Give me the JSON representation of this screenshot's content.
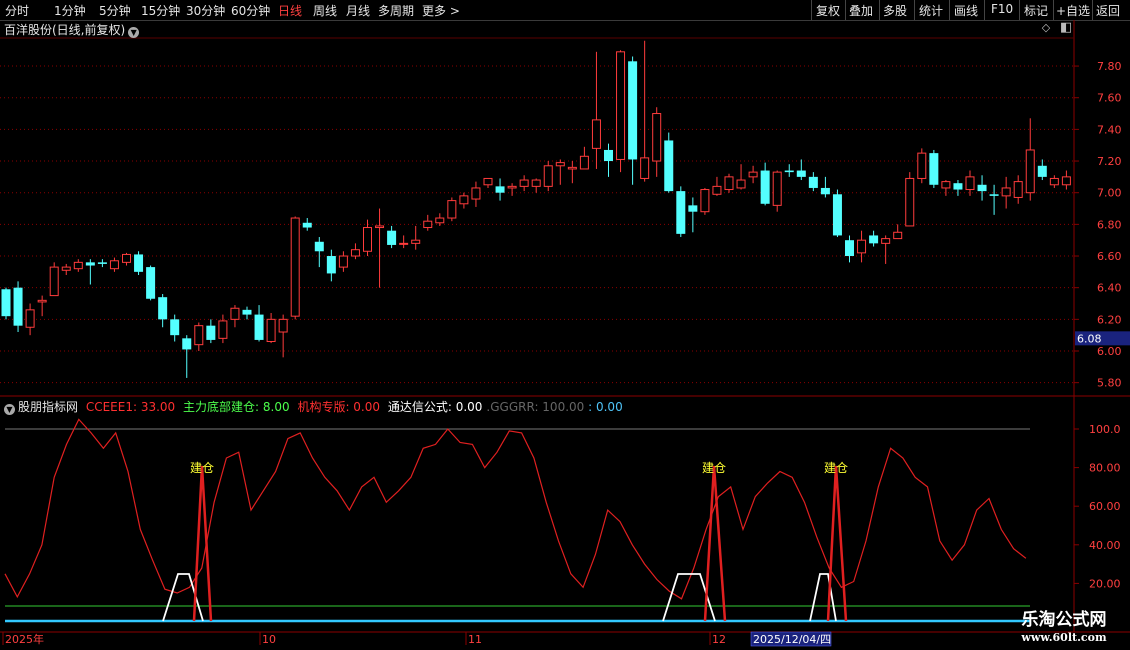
{
  "toolbar": {
    "periods": [
      "分时",
      "1分钟",
      "5分钟",
      "15分钟",
      "30分钟",
      "60分钟",
      "日线",
      "周线",
      "月线",
      "多周期",
      "更多 >"
    ],
    "active_period": "日线",
    "right_buttons": [
      "复权",
      "叠加",
      "多股",
      "统计",
      "画线",
      "F10",
      "标记",
      "+自选",
      "返回"
    ]
  },
  "main_chart": {
    "title": "百洋股份(日线,前复权)",
    "price_axis": [
      "7.80",
      "7.60",
      "7.40",
      "7.20",
      "7.00",
      "6.80",
      "6.60",
      "6.40",
      "6.20",
      "6.00",
      "5.80"
    ],
    "current_price_tag": "6.08",
    "colors": {
      "up": "#ff3c3c",
      "down": "#54ffff",
      "grid": "#8b0000",
      "tag_bg": "#1a237e"
    }
  },
  "indicator": {
    "name": "股朋指标网",
    "values": [
      {
        "label": "CCEEE1: 33.00",
        "color": "#ff3030"
      },
      {
        "label": "主力底部建仓: 8.00",
        "color": "#4cff4c"
      },
      {
        "label": "机构专版: 0.00",
        "color": "#ff3030"
      },
      {
        "label": "通达信公式: 0.00",
        "color": "#ffffff"
      },
      {
        "label": ".GGGRR: 100.00",
        "color": "#666666"
      },
      {
        "label": ": 0.00",
        "color": "#4fc3f7"
      }
    ],
    "axis": [
      "100.0",
      "80.00",
      "60.00",
      "40.00",
      "20.00"
    ],
    "signal_label": "建仓",
    "signal_color": "#ffff33"
  },
  "date_axis": {
    "labels": [
      "2025年",
      "10",
      "11",
      "12"
    ],
    "cursor_date": "2025/12/04/四"
  },
  "watermark": {
    "line1": "乐淘公式网",
    "line2": "www.60lt.com"
  },
  "chart_data": [
    {
      "type": "candlestick",
      "title": "百洋股份(日线,前复权)",
      "ylim": [
        5.75,
        7.95
      ],
      "candles": [
        [
          6.39,
          6.22,
          6.4,
          6.2
        ],
        [
          6.4,
          6.16,
          6.44,
          6.12
        ],
        [
          6.15,
          6.26,
          6.3,
          6.1
        ],
        [
          6.31,
          6.32,
          6.35,
          6.22
        ],
        [
          6.35,
          6.53,
          6.56,
          6.35
        ],
        [
          6.51,
          6.53,
          6.55,
          6.48
        ],
        [
          6.52,
          6.56,
          6.58,
          6.5
        ],
        [
          6.56,
          6.54,
          6.58,
          6.42
        ],
        [
          6.56,
          6.55,
          6.58,
          6.53
        ],
        [
          6.52,
          6.57,
          6.59,
          6.5
        ],
        [
          6.56,
          6.61,
          6.62,
          6.54
        ],
        [
          6.61,
          6.5,
          6.63,
          6.48
        ],
        [
          6.53,
          6.33,
          6.54,
          6.32
        ],
        [
          6.34,
          6.2,
          6.36,
          6.15
        ],
        [
          6.2,
          6.1,
          6.23,
          6.06
        ],
        [
          6.08,
          6.01,
          6.1,
          5.83
        ],
        [
          6.04,
          6.16,
          6.18,
          6.0
        ],
        [
          6.16,
          6.07,
          6.2,
          6.05
        ],
        [
          6.08,
          6.19,
          6.23,
          6.05
        ],
        [
          6.2,
          6.27,
          6.29,
          6.15
        ],
        [
          6.26,
          6.23,
          6.28,
          6.2
        ],
        [
          6.23,
          6.07,
          6.29,
          6.06
        ],
        [
          6.06,
          6.2,
          6.24,
          6.05
        ],
        [
          6.12,
          6.2,
          6.23,
          5.96
        ],
        [
          6.22,
          6.84,
          6.85,
          6.2
        ],
        [
          6.81,
          6.78,
          6.84,
          6.76
        ],
        [
          6.69,
          6.63,
          6.72,
          6.53
        ],
        [
          6.6,
          6.49,
          6.64,
          6.44
        ],
        [
          6.53,
          6.6,
          6.63,
          6.5
        ],
        [
          6.6,
          6.64,
          6.68,
          6.58
        ],
        [
          6.63,
          6.78,
          6.83,
          6.6
        ],
        [
          6.78,
          6.79,
          6.9,
          6.4
        ],
        [
          6.76,
          6.67,
          6.79,
          6.65
        ],
        [
          6.68,
          6.68,
          6.73,
          6.65
        ],
        [
          6.68,
          6.7,
          6.79,
          6.64
        ],
        [
          6.78,
          6.82,
          6.86,
          6.76
        ],
        [
          6.81,
          6.84,
          6.87,
          6.79
        ],
        [
          6.84,
          6.95,
          6.97,
          6.82
        ],
        [
          6.93,
          6.98,
          7.0,
          6.9
        ],
        [
          6.96,
          7.03,
          7.07,
          6.91
        ],
        [
          7.05,
          7.09,
          7.09,
          7.03
        ],
        [
          7.04,
          7.0,
          7.09,
          6.95
        ],
        [
          7.03,
          7.04,
          7.06,
          6.98
        ],
        [
          7.04,
          7.08,
          7.11,
          7.01
        ],
        [
          7.04,
          7.08,
          7.09,
          7.0
        ],
        [
          7.04,
          7.17,
          7.2,
          7.01
        ],
        [
          7.17,
          7.19,
          7.21,
          7.05
        ],
        [
          7.15,
          7.16,
          7.2,
          7.06
        ],
        [
          7.15,
          7.23,
          7.29,
          7.15
        ],
        [
          7.28,
          7.46,
          7.89,
          7.15
        ],
        [
          7.27,
          7.2,
          7.31,
          7.1
        ],
        [
          7.21,
          7.89,
          7.9,
          7.13
        ],
        [
          7.83,
          7.21,
          7.86,
          7.05
        ],
        [
          7.09,
          7.22,
          7.96,
          7.07
        ],
        [
          7.2,
          7.5,
          7.54,
          7.1
        ],
        [
          7.33,
          7.01,
          7.38,
          7.0
        ],
        [
          7.01,
          6.74,
          7.04,
          6.72
        ],
        [
          6.92,
          6.88,
          6.97,
          6.75
        ],
        [
          6.88,
          7.02,
          7.03,
          6.86
        ],
        [
          6.99,
          7.04,
          7.1,
          6.98
        ],
        [
          7.02,
          7.1,
          7.12,
          7.0
        ],
        [
          7.03,
          7.08,
          7.18,
          7.02
        ],
        [
          7.1,
          7.13,
          7.17,
          7.06
        ],
        [
          7.14,
          6.93,
          7.19,
          6.92
        ],
        [
          6.92,
          7.13,
          7.14,
          6.88
        ],
        [
          7.14,
          7.13,
          7.18,
          7.1
        ],
        [
          7.14,
          7.1,
          7.21,
          7.08
        ],
        [
          7.1,
          7.03,
          7.13,
          7.01
        ],
        [
          7.03,
          6.99,
          7.1,
          6.97
        ],
        [
          6.99,
          6.73,
          7.02,
          6.72
        ],
        [
          6.7,
          6.6,
          6.73,
          6.56
        ],
        [
          6.62,
          6.7,
          6.76,
          6.56
        ],
        [
          6.73,
          6.68,
          6.76,
          6.66
        ],
        [
          6.68,
          6.71,
          6.73,
          6.55
        ],
        [
          6.71,
          6.75,
          6.8,
          6.71
        ],
        [
          6.79,
          7.09,
          7.13,
          6.8
        ],
        [
          7.09,
          7.25,
          7.28,
          7.06
        ],
        [
          7.25,
          7.05,
          7.27,
          7.03
        ],
        [
          7.03,
          7.07,
          7.08,
          6.98
        ],
        [
          7.06,
          7.02,
          7.08,
          6.98
        ],
        [
          7.02,
          7.1,
          7.14,
          6.98
        ],
        [
          7.05,
          7.01,
          7.11,
          6.95
        ],
        [
          6.99,
          6.98,
          7.05,
          6.86
        ],
        [
          6.98,
          7.03,
          7.1,
          6.9
        ],
        [
          6.97,
          7.07,
          7.11,
          6.93
        ],
        [
          7.0,
          7.27,
          7.47,
          6.95
        ],
        [
          7.17,
          7.1,
          7.21,
          7.08
        ],
        [
          7.05,
          7.09,
          7.11,
          7.03
        ],
        [
          7.05,
          7.1,
          7.14,
          7.02
        ]
      ]
    },
    {
      "type": "line",
      "ylim": [
        0,
        120
      ],
      "series": [
        {
          "name": "CCEEE1",
          "values": [
            25,
            13,
            25,
            40,
            75,
            92,
            105,
            98,
            90,
            98,
            78,
            48,
            32,
            17,
            15,
            18,
            28,
            62,
            85,
            88,
            58,
            68,
            78,
            95,
            98,
            85,
            75,
            68,
            58,
            70,
            75,
            62,
            68,
            75,
            90,
            92,
            100,
            93,
            92,
            80,
            88,
            99,
            98,
            85,
            62,
            42,
            25,
            18,
            35,
            58,
            52,
            40,
            30,
            22,
            16,
            12,
            28,
            48,
            65,
            70,
            48,
            65,
            72,
            78,
            75,
            62,
            44,
            28,
            18,
            21,
            42,
            70,
            90,
            85,
            75,
            70,
            42,
            32,
            40,
            58,
            64,
            48,
            38,
            33
          ]
        },
        {
          "name": "主力底部建仓",
          "values": []
        },
        {
          "name": "机构专版",
          "values": []
        }
      ],
      "signals": [
        {
          "label": "建仓",
          "x_index": 16
        },
        {
          "label": "建仓",
          "x_index": 58
        },
        {
          "label": "建仓",
          "x_index": 68
        }
      ]
    }
  ]
}
